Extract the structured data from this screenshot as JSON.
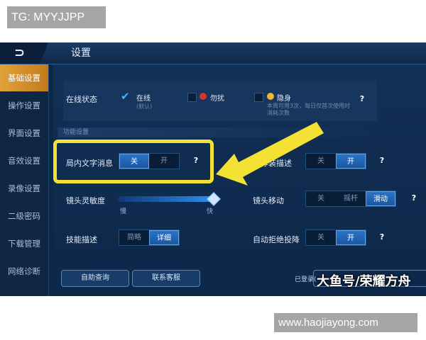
{
  "watermarks": {
    "top": "TG: MYYJJPP",
    "middle": "大鱼号/荣耀方舟",
    "bottom": "www.haojiayong.com"
  },
  "header": {
    "back_glyph": "⊃",
    "title": "设置"
  },
  "sidebar": {
    "items": [
      {
        "label": "基础设置",
        "active": true
      },
      {
        "label": "操作设置"
      },
      {
        "label": "界面设置"
      },
      {
        "label": "音效设置"
      },
      {
        "label": "录像设置"
      },
      {
        "label": "二级密码"
      },
      {
        "label": "下载管理"
      },
      {
        "label": "网络诊断"
      }
    ]
  },
  "online": {
    "label": "在线状态",
    "options": [
      {
        "label": "在线",
        "sub": "(默认)",
        "checked": true
      },
      {
        "label": "勿扰",
        "icon": "no-entry-icon"
      },
      {
        "label": "隐身",
        "icon": "emoji-icon",
        "sub1": "本周可用3次，每日仅首次使用时",
        "sub2": "消耗次数"
      }
    ]
  },
  "section_label": "功能设置",
  "settings": {
    "chat": {
      "label": "局内文字消息",
      "options": [
        "关",
        "开"
      ],
      "selected": 0
    },
    "equip": {
      "label": "推荐装描述",
      "options": [
        "关",
        "开"
      ],
      "selected": 1
    },
    "camera_sens": {
      "label": "镜头灵敏度",
      "min_label": "慢",
      "max_label": "快",
      "value": 1.0
    },
    "camera_move": {
      "label": "镜头移动",
      "options": [
        "关",
        "摇杆",
        "滑动"
      ],
      "selected": 2
    },
    "skill_desc": {
      "label": "技能描述",
      "options": [
        "简略",
        "详细"
      ],
      "selected": 1
    },
    "auto_reject": {
      "label": "自动拒绝投降",
      "options": [
        "关",
        "开"
      ],
      "selected": 1
    }
  },
  "buttons": {
    "self_help": "自助查询",
    "service": "联系客服",
    "logged_in": "已登录("
  },
  "help_glyph": "?",
  "colors": {
    "highlight": "#f3e233",
    "active_tab": "#d48e2a",
    "accent": "#2b73c6"
  }
}
